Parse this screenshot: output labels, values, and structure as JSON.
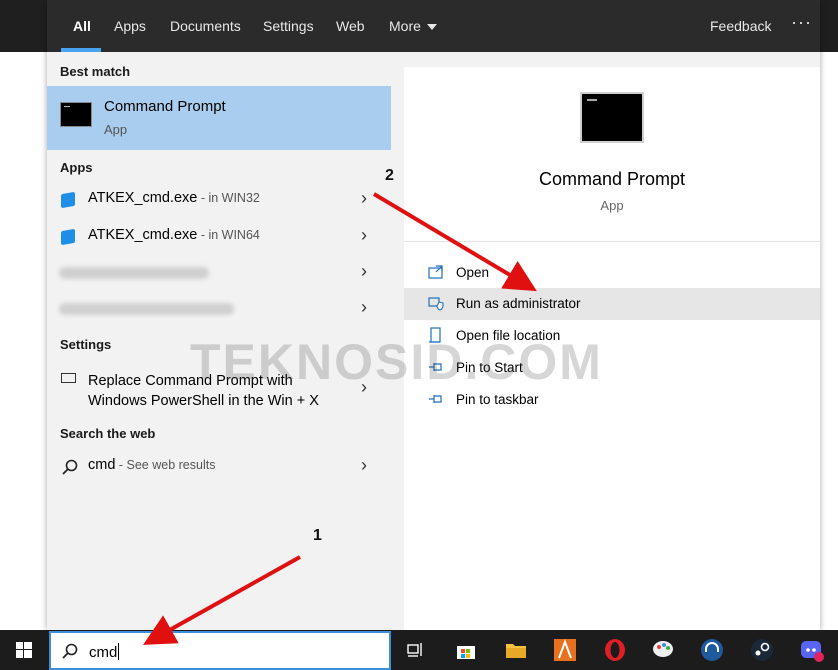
{
  "tabs": {
    "all": "All",
    "apps": "Apps",
    "documents": "Documents",
    "settings": "Settings",
    "web": "Web",
    "more": "More",
    "feedback": "Feedback",
    "more_options": "···"
  },
  "sections": {
    "best_match": "Best match",
    "apps": "Apps",
    "settings": "Settings",
    "search_web": "Search the web"
  },
  "best_match": {
    "title": "Command Prompt",
    "subtitle": "App",
    "icon": "cmd-icon"
  },
  "apps": [
    {
      "name": "ATKEX_cmd.exe",
      "location": " - in WIN32",
      "icon": "app-cube-icon"
    },
    {
      "name": "ATKEX_cmd.exe",
      "location": " - in WIN64",
      "icon": "app-cube-icon"
    }
  ],
  "settings_item": {
    "label_line1": "Replace Command Prompt with",
    "label_line2": "Windows PowerShell in the Win + X"
  },
  "web_search": {
    "query": "cmd",
    "suffix": " - See web results"
  },
  "detail": {
    "title": "Command Prompt",
    "subtitle": "App",
    "actions": [
      {
        "label": "Open",
        "icon": "open-icon"
      },
      {
        "label": "Run as administrator",
        "icon": "shield-icon",
        "highlighted": true
      },
      {
        "label": "Open file location",
        "icon": "file-location-icon"
      },
      {
        "label": "Pin to Start",
        "icon": "pin-icon"
      },
      {
        "label": "Pin to taskbar",
        "icon": "pin-icon"
      }
    ]
  },
  "search_box": {
    "value": "cmd"
  },
  "watermark": "TEKNOSID.COM",
  "annotations": {
    "step1": "1",
    "step2": "2",
    "arrow_color": "#e01010"
  },
  "colors": {
    "accent": "#4aa3f0",
    "best_match_bg": "#a9cdee",
    "taskbar": "#1c1c1c"
  },
  "taskbar_icons": [
    "windows-start-icon",
    "task-view-icon",
    "store-icon",
    "file-explorer-icon",
    "app-a-icon",
    "opera-icon",
    "paint-icon",
    "headset-icon",
    "steam-icon",
    "discord-icon"
  ]
}
